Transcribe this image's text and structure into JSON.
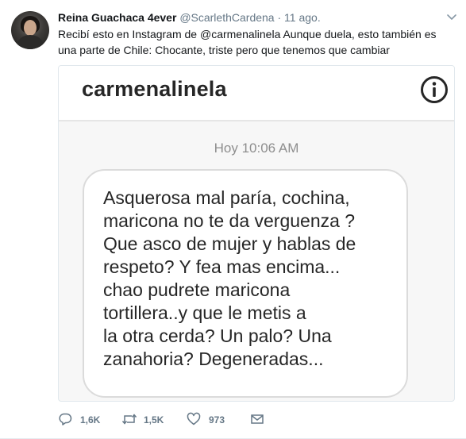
{
  "tweet": {
    "display_name": "Reina Guachaca 4ever",
    "handle": "@ScarlethCardena",
    "separator": "·",
    "date": "11 ago.",
    "text": "Recibí esto en Instagram de @carmenalinela Aunque duela, esto también es una parte de Chile: Chocante, triste pero que tenemos que cambiar",
    "caret_icon": "chevron-down-icon"
  },
  "media": {
    "instagram_username": "carmenalinela",
    "info_icon": "info-icon",
    "message_time": "Hoy 10:06 AM",
    "message_text": "Asquerosa  mal paría, cochina,\nmaricona no te da verguenza ?\nQue asco de mujer y hablas de\nrespeto? Y fea mas encima...\nchao pudrete maricona\ntortillera..y que le metis a\nla otra cerda? Un palo? Una\nzanahoria? Degeneradas..."
  },
  "actions": {
    "reply": {
      "icon": "reply-icon",
      "count": "1,6K"
    },
    "retweet": {
      "icon": "retweet-icon",
      "count": "1,5K"
    },
    "like": {
      "icon": "heart-icon",
      "count": "973"
    },
    "message": {
      "icon": "envelope-icon"
    }
  },
  "colors": {
    "text": "#14171a",
    "secondary": "#657786",
    "border": "#e6ecf0"
  }
}
